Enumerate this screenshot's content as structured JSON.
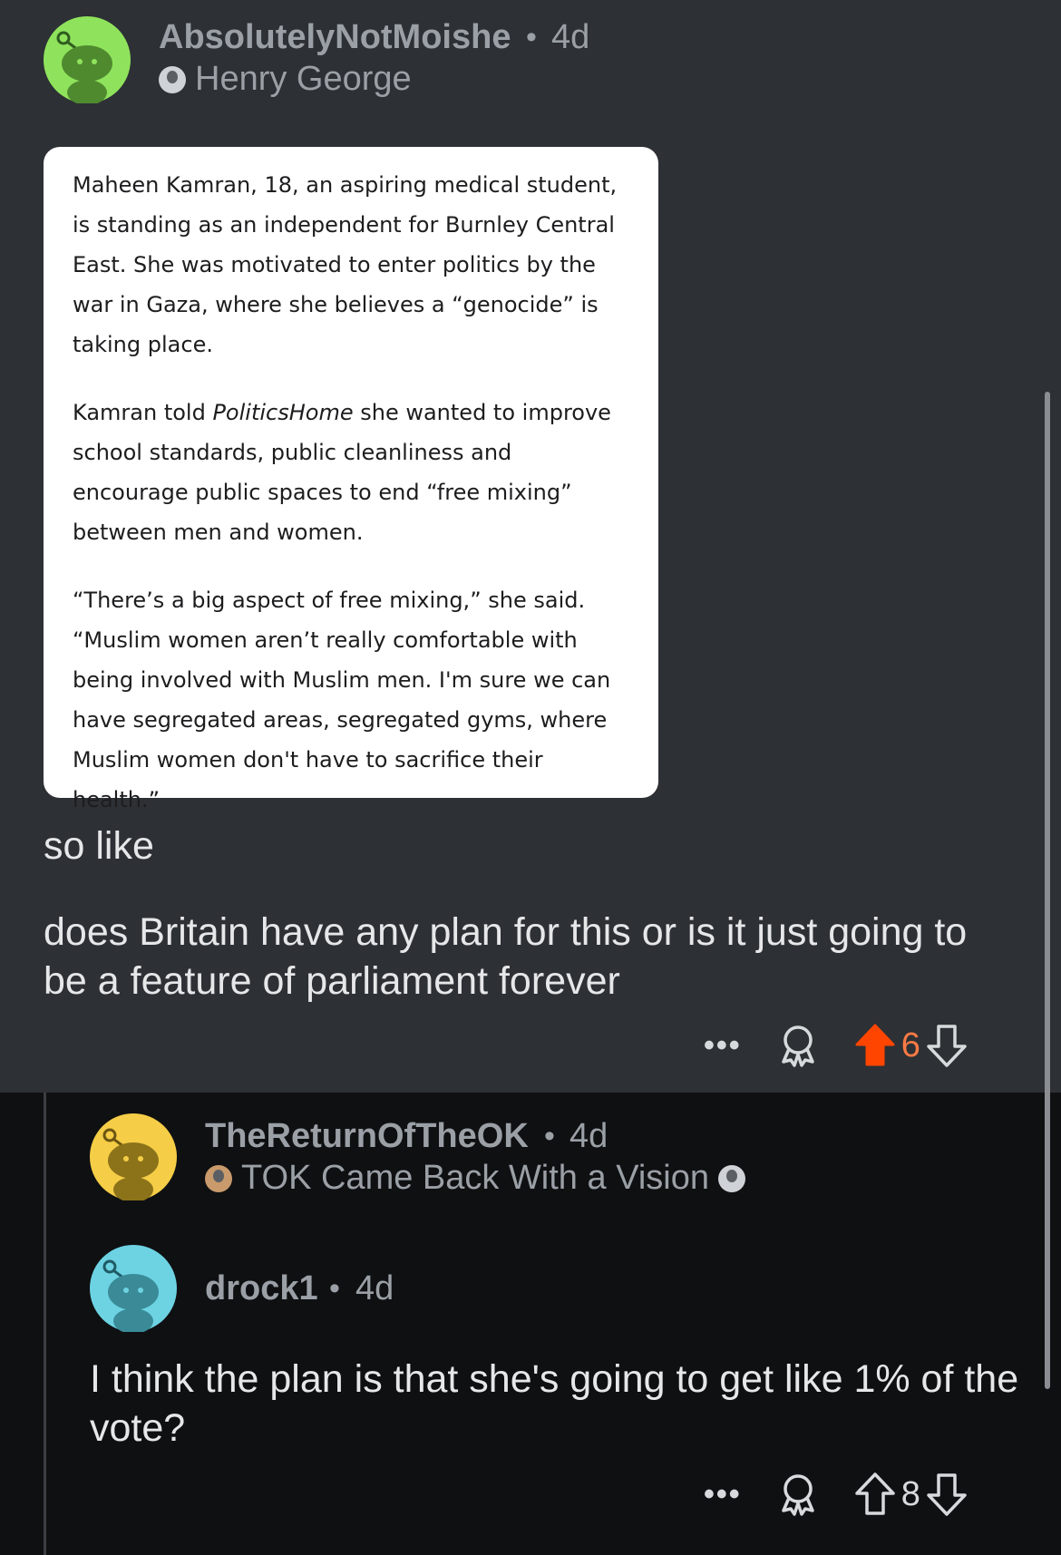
{
  "post": {
    "username": "AbsolutelyNotMoishe",
    "separator": "•",
    "age": "4d",
    "flair": "Henry George",
    "avatar_color": "#8fe35c",
    "quote": {
      "p1": "Maheen Kamran, 18, an aspiring medical student, is standing as an independent for Burnley Central East. She was motivated to enter politics by the war in Gaza, where she believes a “genocide” is taking place.",
      "p2_before": "Kamran told ",
      "p2_italic": "PoliticsHome",
      "p2_after": " she wanted to improve school standards, public cleanliness and encourage public spaces to end “free mixing” between men and women.",
      "p3": "“There’s a big aspect of free mixing,” she said. “Muslim women aren’t really comfortable with being involved with Muslim men. I'm sure we can have segregated areas, segregated gyms, where Muslim women don't have to sacrifice their health.”"
    },
    "body_line1": "so like",
    "body_line2": "does Britain have any plan for this or is it just going to be a feature of parliament forever",
    "actions": {
      "more": "•••",
      "vote_count": "6",
      "upvote_active": true,
      "upvote_color": "#ff4500",
      "count_color": "#ff7a45"
    }
  },
  "reply1": {
    "username": "TheReturnOfTheOK",
    "separator": "•",
    "age": "4d",
    "flair": "TOK Came Back With a Vision",
    "avatar_color": "#f5cd47"
  },
  "reply2": {
    "username": "drock1",
    "separator": "•",
    "age": "4d",
    "avatar_color": "#6dd3e3",
    "body": "I think the plan is that she's going to get like 1% of the vote?",
    "actions": {
      "more": "•••",
      "vote_count": "8",
      "upvote_active": false
    }
  }
}
